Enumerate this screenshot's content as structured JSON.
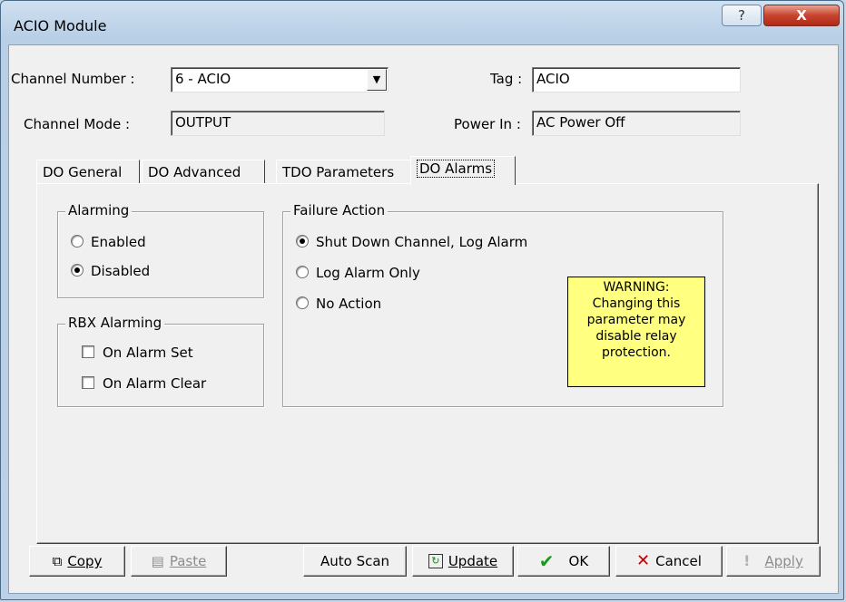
{
  "window": {
    "title": "ACIO Module",
    "help_label": "?",
    "close_label": "X"
  },
  "header": {
    "channel_number_label": "Channel Number :",
    "channel_number_value": "6 - ACIO",
    "tag_label": "Tag :",
    "tag_value": "ACIO",
    "channel_mode_label": "Channel Mode :",
    "channel_mode_value": "OUTPUT",
    "power_in_label": "Power In :",
    "power_in_value": "AC Power Off"
  },
  "tabs": [
    {
      "label": "DO General"
    },
    {
      "label": "DO Advanced"
    },
    {
      "label": "TDO Parameters"
    },
    {
      "label": "DO Alarms",
      "active": true
    }
  ],
  "alarming": {
    "title": "Alarming",
    "options": [
      {
        "label": "Enabled",
        "selected": false
      },
      {
        "label": "Disabled",
        "selected": true
      }
    ]
  },
  "rbx_alarming": {
    "title": "RBX Alarming",
    "options": [
      {
        "label": "On Alarm Set",
        "checked": false
      },
      {
        "label": "On Alarm Clear",
        "checked": false
      }
    ]
  },
  "failure_action": {
    "title": "Failure Action",
    "options": [
      {
        "label": "Shut Down Channel, Log Alarm",
        "selected": true
      },
      {
        "label": "Log Alarm Only",
        "selected": false
      },
      {
        "label": "No Action",
        "selected": false
      }
    ],
    "warning_lines": [
      "WARNING:",
      "Changing this",
      "parameter may",
      "disable relay",
      "protection."
    ],
    "warning_color": "#ffff80"
  },
  "buttons": {
    "copy": "Copy",
    "paste": "Paste",
    "auto_scan": "Auto Scan",
    "update": "Update",
    "ok": "OK",
    "cancel": "Cancel",
    "apply": "Apply"
  }
}
